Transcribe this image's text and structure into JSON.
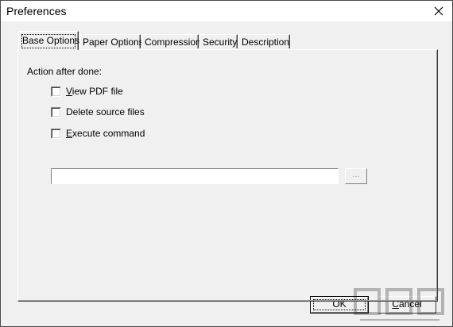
{
  "window": {
    "title": "Preferences",
    "close_glyph": "✕"
  },
  "tabs": [
    {
      "label": "Base Options",
      "active": true
    },
    {
      "label": "Paper Options",
      "active": false
    },
    {
      "label": "Compression",
      "active": false
    },
    {
      "label": "Security",
      "active": false
    },
    {
      "label": "Description",
      "active": false
    }
  ],
  "base_options": {
    "group_label": "Action after done:",
    "view_pdf": {
      "label_u": "V",
      "label_rest": "iew PDF file",
      "checked": false
    },
    "delete_source": {
      "label": "Delete source files",
      "checked": false
    },
    "execute_command": {
      "label_u": "E",
      "label_rest": "xecute command",
      "checked": false
    },
    "command_value": "",
    "browse_label": "..."
  },
  "buttons": {
    "ok": {
      "label": "OK"
    },
    "cancel": {
      "label_u": "C",
      "label_rest": "ancel"
    }
  },
  "colors": {
    "face": "#f0f0f0",
    "title_bg": "#ffffff"
  }
}
